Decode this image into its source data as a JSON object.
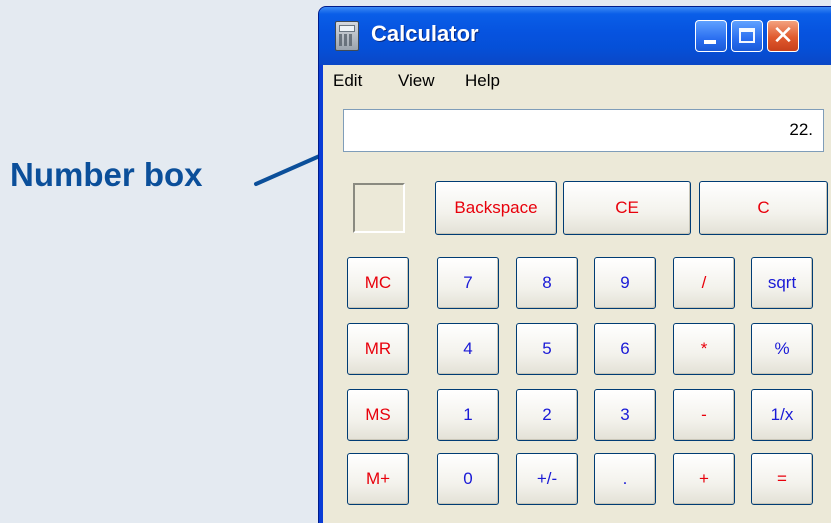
{
  "annotation": {
    "label": "Number box"
  },
  "window": {
    "title": "Calculator",
    "controls": {
      "minimize": "minimize",
      "maximize": "maximize",
      "close": "close"
    }
  },
  "menu": {
    "edit": "Edit",
    "view": "View",
    "help": "Help"
  },
  "display": {
    "value": "22."
  },
  "keys": {
    "backspace": "Backspace",
    "ce": "CE",
    "c": "C",
    "mc": "MC",
    "mr": "MR",
    "ms": "MS",
    "m_plus": "M+",
    "seven": "7",
    "eight": "8",
    "nine": "9",
    "divide": "/",
    "sqrt": "sqrt",
    "four": "4",
    "five": "5",
    "six": "6",
    "multiply": "*",
    "percent": "%",
    "one": "1",
    "two": "2",
    "three": "3",
    "minus": "-",
    "reciprocal": "1/x",
    "zero": "0",
    "plus_minus": "+/-",
    "decimal": ".",
    "plus": "+",
    "equals": "="
  },
  "colors": {
    "operator_text": "#e8000b",
    "digit_text": "#1a1ad6",
    "titlebar": "#0653df",
    "annotation_text": "#0b4f9a"
  },
  "icons": {
    "app": "calculator-icon",
    "minimize": "minimize-icon",
    "maximize": "maximize-icon",
    "close": "close-icon",
    "annotation_arrow": "arrow-icon"
  }
}
